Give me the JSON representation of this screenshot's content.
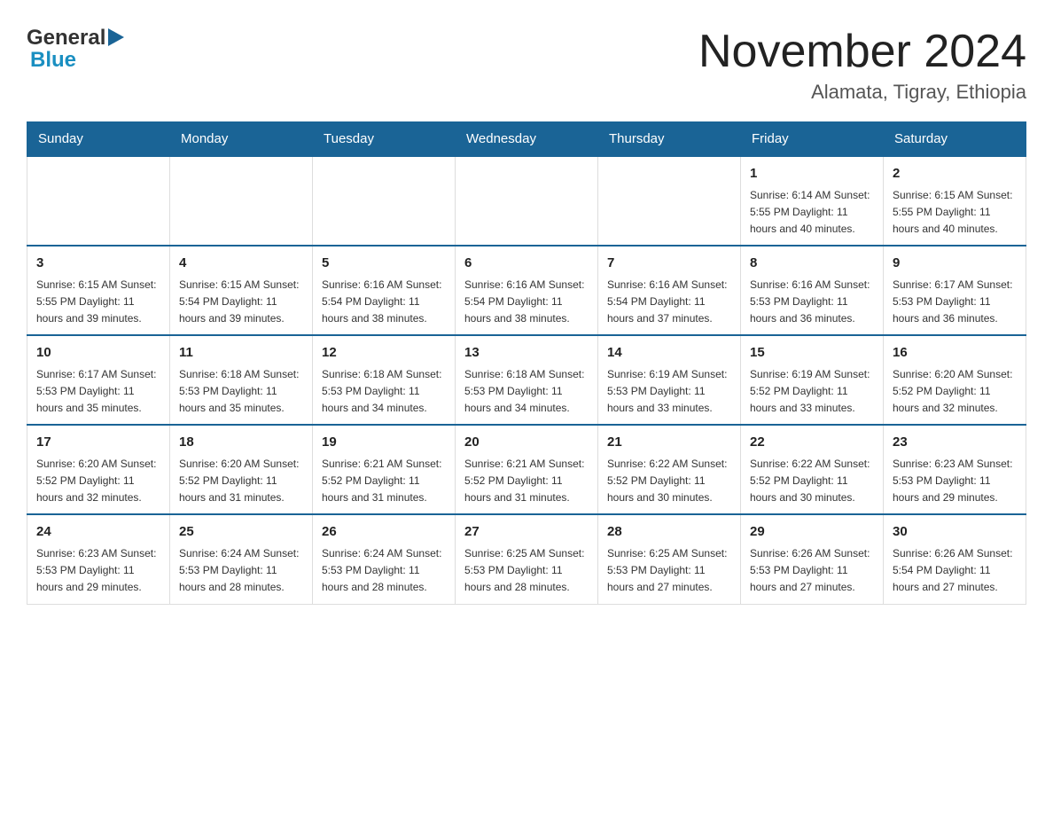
{
  "header": {
    "logo_general": "General",
    "logo_blue": "Blue",
    "month_title": "November 2024",
    "location": "Alamata, Tigray, Ethiopia"
  },
  "calendar": {
    "days_of_week": [
      "Sunday",
      "Monday",
      "Tuesday",
      "Wednesday",
      "Thursday",
      "Friday",
      "Saturday"
    ],
    "weeks": [
      {
        "days": [
          {
            "number": "",
            "info": ""
          },
          {
            "number": "",
            "info": ""
          },
          {
            "number": "",
            "info": ""
          },
          {
            "number": "",
            "info": ""
          },
          {
            "number": "",
            "info": ""
          },
          {
            "number": "1",
            "info": "Sunrise: 6:14 AM\nSunset: 5:55 PM\nDaylight: 11 hours\nand 40 minutes."
          },
          {
            "number": "2",
            "info": "Sunrise: 6:15 AM\nSunset: 5:55 PM\nDaylight: 11 hours\nand 40 minutes."
          }
        ]
      },
      {
        "days": [
          {
            "number": "3",
            "info": "Sunrise: 6:15 AM\nSunset: 5:55 PM\nDaylight: 11 hours\nand 39 minutes."
          },
          {
            "number": "4",
            "info": "Sunrise: 6:15 AM\nSunset: 5:54 PM\nDaylight: 11 hours\nand 39 minutes."
          },
          {
            "number": "5",
            "info": "Sunrise: 6:16 AM\nSunset: 5:54 PM\nDaylight: 11 hours\nand 38 minutes."
          },
          {
            "number": "6",
            "info": "Sunrise: 6:16 AM\nSunset: 5:54 PM\nDaylight: 11 hours\nand 38 minutes."
          },
          {
            "number": "7",
            "info": "Sunrise: 6:16 AM\nSunset: 5:54 PM\nDaylight: 11 hours\nand 37 minutes."
          },
          {
            "number": "8",
            "info": "Sunrise: 6:16 AM\nSunset: 5:53 PM\nDaylight: 11 hours\nand 36 minutes."
          },
          {
            "number": "9",
            "info": "Sunrise: 6:17 AM\nSunset: 5:53 PM\nDaylight: 11 hours\nand 36 minutes."
          }
        ]
      },
      {
        "days": [
          {
            "number": "10",
            "info": "Sunrise: 6:17 AM\nSunset: 5:53 PM\nDaylight: 11 hours\nand 35 minutes."
          },
          {
            "number": "11",
            "info": "Sunrise: 6:18 AM\nSunset: 5:53 PM\nDaylight: 11 hours\nand 35 minutes."
          },
          {
            "number": "12",
            "info": "Sunrise: 6:18 AM\nSunset: 5:53 PM\nDaylight: 11 hours\nand 34 minutes."
          },
          {
            "number": "13",
            "info": "Sunrise: 6:18 AM\nSunset: 5:53 PM\nDaylight: 11 hours\nand 34 minutes."
          },
          {
            "number": "14",
            "info": "Sunrise: 6:19 AM\nSunset: 5:53 PM\nDaylight: 11 hours\nand 33 minutes."
          },
          {
            "number": "15",
            "info": "Sunrise: 6:19 AM\nSunset: 5:52 PM\nDaylight: 11 hours\nand 33 minutes."
          },
          {
            "number": "16",
            "info": "Sunrise: 6:20 AM\nSunset: 5:52 PM\nDaylight: 11 hours\nand 32 minutes."
          }
        ]
      },
      {
        "days": [
          {
            "number": "17",
            "info": "Sunrise: 6:20 AM\nSunset: 5:52 PM\nDaylight: 11 hours\nand 32 minutes."
          },
          {
            "number": "18",
            "info": "Sunrise: 6:20 AM\nSunset: 5:52 PM\nDaylight: 11 hours\nand 31 minutes."
          },
          {
            "number": "19",
            "info": "Sunrise: 6:21 AM\nSunset: 5:52 PM\nDaylight: 11 hours\nand 31 minutes."
          },
          {
            "number": "20",
            "info": "Sunrise: 6:21 AM\nSunset: 5:52 PM\nDaylight: 11 hours\nand 31 minutes."
          },
          {
            "number": "21",
            "info": "Sunrise: 6:22 AM\nSunset: 5:52 PM\nDaylight: 11 hours\nand 30 minutes."
          },
          {
            "number": "22",
            "info": "Sunrise: 6:22 AM\nSunset: 5:52 PM\nDaylight: 11 hours\nand 30 minutes."
          },
          {
            "number": "23",
            "info": "Sunrise: 6:23 AM\nSunset: 5:53 PM\nDaylight: 11 hours\nand 29 minutes."
          }
        ]
      },
      {
        "days": [
          {
            "number": "24",
            "info": "Sunrise: 6:23 AM\nSunset: 5:53 PM\nDaylight: 11 hours\nand 29 minutes."
          },
          {
            "number": "25",
            "info": "Sunrise: 6:24 AM\nSunset: 5:53 PM\nDaylight: 11 hours\nand 28 minutes."
          },
          {
            "number": "26",
            "info": "Sunrise: 6:24 AM\nSunset: 5:53 PM\nDaylight: 11 hours\nand 28 minutes."
          },
          {
            "number": "27",
            "info": "Sunrise: 6:25 AM\nSunset: 5:53 PM\nDaylight: 11 hours\nand 28 minutes."
          },
          {
            "number": "28",
            "info": "Sunrise: 6:25 AM\nSunset: 5:53 PM\nDaylight: 11 hours\nand 27 minutes."
          },
          {
            "number": "29",
            "info": "Sunrise: 6:26 AM\nSunset: 5:53 PM\nDaylight: 11 hours\nand 27 minutes."
          },
          {
            "number": "30",
            "info": "Sunrise: 6:26 AM\nSunset: 5:54 PM\nDaylight: 11 hours\nand 27 minutes."
          }
        ]
      }
    ]
  }
}
